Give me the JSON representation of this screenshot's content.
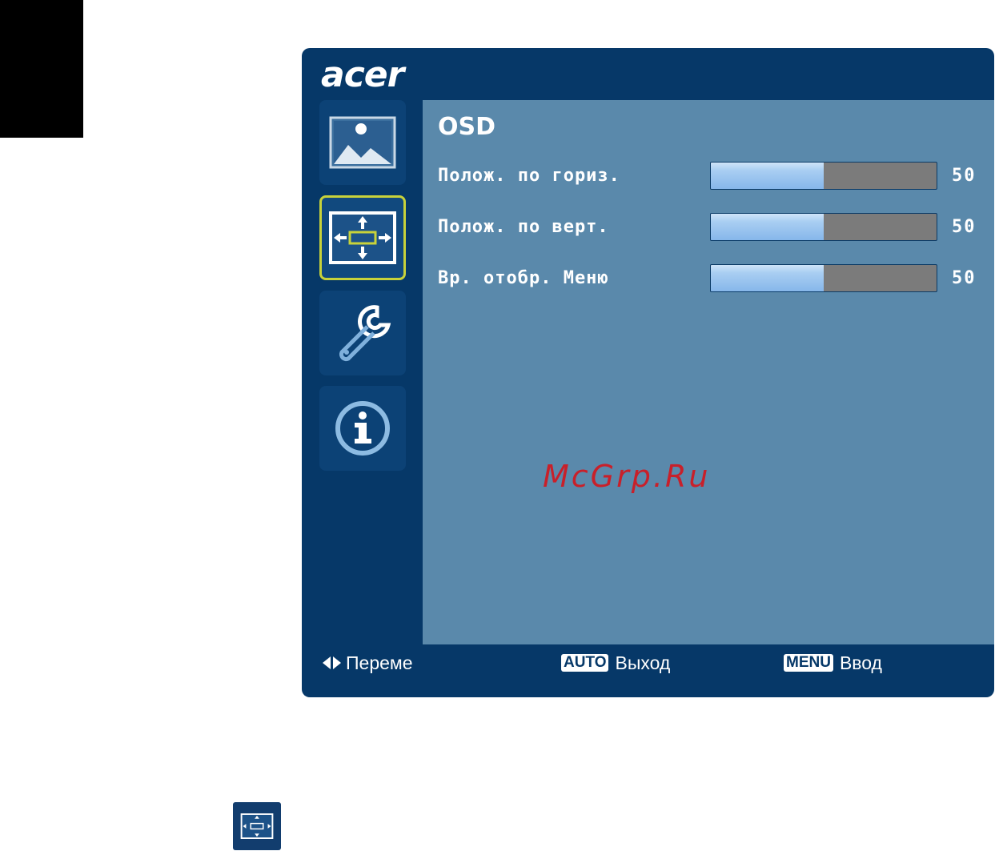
{
  "brand": {
    "logo_text": "acer"
  },
  "sidebar": {
    "items": [
      {
        "name": "picture",
        "icon": "picture-icon",
        "active": false
      },
      {
        "name": "osd-position",
        "icon": "osd-position-icon",
        "active": true
      },
      {
        "name": "settings",
        "icon": "wrench-icon",
        "active": false
      },
      {
        "name": "information",
        "icon": "info-icon",
        "active": false
      }
    ]
  },
  "content": {
    "title": "OSD",
    "rows": [
      {
        "label": "Полож. по гориз.",
        "value": "50",
        "level": 0.5
      },
      {
        "label": "Полож. по верт.",
        "value": "50",
        "level": 0.5
      },
      {
        "label": "Вр. отобр. Меню",
        "value": "50",
        "level": 0.5
      }
    ]
  },
  "watermark": {
    "text": "McGrp.Ru"
  },
  "footer": {
    "move_label": "Переме",
    "exit_key": "AUTO",
    "exit_label": "Выход",
    "enter_key": "MENU",
    "enter_label": "Ввод"
  },
  "colors": {
    "frame": "#063868",
    "panel": "#5a89ab",
    "active_border": "#c8d23a",
    "watermark": "#c8202a"
  }
}
